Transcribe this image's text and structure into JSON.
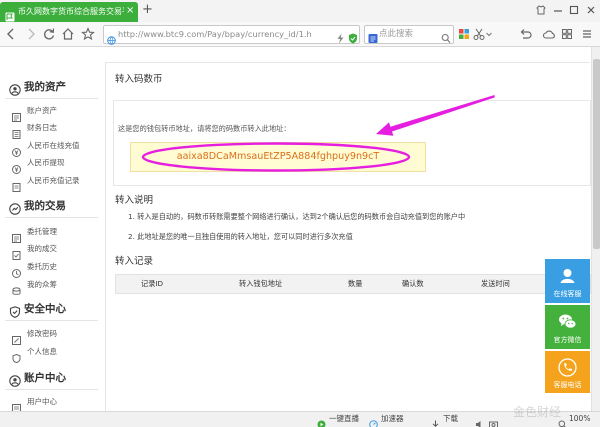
{
  "browser": {
    "tab_title": "币久网数字货币综合服务交易平",
    "tab_close": "×",
    "new_tab": "+",
    "address_url": "http://www.btc9.com/Pay/bpay/currency_id/1.h",
    "search_placeholder": "点此搜索",
    "status_bar": {
      "live": "一键直播",
      "accelerator": "加速器",
      "download": "下载",
      "zoom": "100%"
    },
    "icons": [
      "back-icon",
      "forward-icon",
      "refresh-icon",
      "home-icon",
      "star-icon",
      "globe-icon",
      "lightning-icon",
      "security-icon",
      "search-icon",
      "apps-icon",
      "scissors-icon",
      "undo-icon",
      "cloud-icon",
      "grid-icon",
      "menu-icon"
    ]
  },
  "sidebar": {
    "sections": [
      {
        "title": "我的资产",
        "icon": "wallet-icon",
        "items": [
          {
            "label": "账户资产",
            "icon": "account-icon"
          },
          {
            "label": "财务日志",
            "icon": "log-icon"
          },
          {
            "label": "人民币在线充值",
            "icon": "deposit-icon"
          },
          {
            "label": "人民币提现",
            "icon": "withdraw-icon"
          },
          {
            "label": "人民币充值记录",
            "icon": "record-icon"
          }
        ]
      },
      {
        "title": "我的交易",
        "icon": "trade-icon",
        "items": [
          {
            "label": "委托管理",
            "icon": "order-icon"
          },
          {
            "label": "我的成交",
            "icon": "deal-icon"
          },
          {
            "label": "委托历史",
            "icon": "history-icon"
          },
          {
            "label": "我的众筹",
            "icon": "crowdfund-icon"
          }
        ]
      },
      {
        "title": "安全中心",
        "icon": "shield-icon",
        "items": [
          {
            "label": "修改密码",
            "icon": "password-icon"
          },
          {
            "label": "个人信息",
            "icon": "profile-icon"
          }
        ]
      },
      {
        "title": "账户中心",
        "icon": "user-icon",
        "items": [
          {
            "label": "用户中心",
            "icon": "user-center-icon"
          }
        ]
      }
    ]
  },
  "main": {
    "deposit_title": "转入码数币",
    "address_hint": "这是您的钱包转币地址，请将您的码数币转入此地址：",
    "wallet_address": "aaixa8DCaMmsauEtZP5A884fghpuy9n9cT",
    "instructions_title": "转入说明",
    "instructions": [
      "1. 转入是自动的，码数币转账需要整个网络进行确认，达到2个确认后您的码数币会自动充值到您的账户中",
      "2. 此地址是您的唯一且独自使用的转入地址，您可以同时进行多次充值"
    ],
    "records_title": "转入记录",
    "records_columns": [
      "记录ID",
      "转入钱包地址",
      "数量",
      "确认数",
      "发送时间"
    ]
  },
  "service_panel": [
    {
      "label": "在线客服",
      "icon": "customer-service-icon",
      "color": "#3a9fe2"
    },
    {
      "label": "官方微信",
      "icon": "wechat-icon",
      "color": "#43b13c"
    },
    {
      "label": "客服电话",
      "icon": "phone-icon",
      "color": "#f5a31c"
    }
  ],
  "colors": {
    "tab": "#3cae3c",
    "wallet_address_text": "#d9711d",
    "notice_background": "#fffbd3",
    "annotation": "#e61ee0"
  },
  "watermark": "金色财经"
}
